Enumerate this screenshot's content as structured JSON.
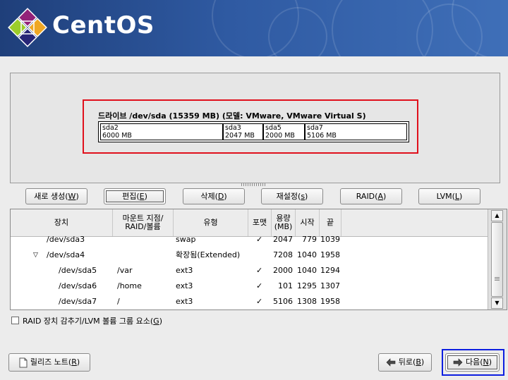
{
  "app": {
    "brand": "CentOS"
  },
  "drive": {
    "label": "드라이브 /dev/sda (15359 MB) (모델: VMware, VMware Virtual S)",
    "segments": [
      {
        "name": "sda2",
        "size": "6000 MB"
      },
      {
        "name": "sda3",
        "size": "2047 MB"
      },
      {
        "name": "sda5",
        "size": "2000 MB"
      },
      {
        "name": "sda7",
        "size": "5106 MB"
      }
    ]
  },
  "actions": {
    "new": {
      "text": "새로 생성(",
      "key": "W",
      "end": ")"
    },
    "edit": {
      "text": "편집(",
      "key": "E",
      "end": ")"
    },
    "delete": {
      "text": "삭제(",
      "key": "D",
      "end": ")"
    },
    "reset": {
      "text": "재설정(",
      "key": "s",
      "end": ")"
    },
    "raid": {
      "text": "RAID(",
      "key": "A",
      "end": ")"
    },
    "lvm": {
      "text": "LVM(",
      "key": "L",
      "end": ")"
    }
  },
  "table": {
    "headers": {
      "device": "장치",
      "mount_line1": "마운트 지점/",
      "mount_line2": "RAID/볼륨",
      "type": "유형",
      "format": "포맷",
      "size_line1": "용량",
      "size_line2": "(MB)",
      "start": "시작",
      "end": "끝"
    },
    "rows": [
      {
        "device": "/dev/sda3",
        "mount": "",
        "type": "swap",
        "format": "✓",
        "size": "2047",
        "start": "779",
        "end": "1039"
      },
      {
        "device": "/dev/sda4",
        "mount": "",
        "type": "확장됨(Extended)",
        "format": "",
        "size": "7208",
        "start": "1040",
        "end": "1958"
      },
      {
        "device": "/dev/sda5",
        "mount": "/var",
        "type": "ext3",
        "format": "✓",
        "size": "2000",
        "start": "1040",
        "end": "1294"
      },
      {
        "device": "/dev/sda6",
        "mount": "/home",
        "type": "ext3",
        "format": "✓",
        "size": "101",
        "start": "1295",
        "end": "1307"
      },
      {
        "device": "/dev/sda7",
        "mount": "/",
        "type": "ext3",
        "format": "✓",
        "size": "5106",
        "start": "1308",
        "end": "1958"
      }
    ]
  },
  "options": {
    "hide_raid": {
      "text": "RAID 장치 감추기/LVM 볼륨 그룹 요소(",
      "key": "G",
      "end": ")",
      "checked": false
    }
  },
  "nav": {
    "release_notes": {
      "text": "릴리즈 노트(",
      "key": "R",
      "end": ")"
    },
    "back": {
      "text": "뒤로(",
      "key": "B",
      "end": ")"
    },
    "next": {
      "text": "다음(",
      "key": "N",
      "end": ")"
    }
  },
  "colors": {
    "highlight_red": "#e0101c",
    "highlight_blue": "#0d1ee0",
    "banner": "#2f5aa2"
  }
}
